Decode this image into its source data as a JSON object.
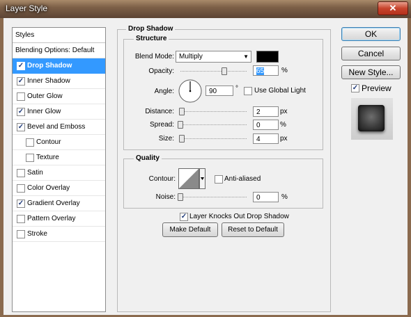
{
  "window": {
    "title": "Layer Style",
    "close_glyph": "✕"
  },
  "styles_panel": {
    "header": "Styles",
    "items": [
      {
        "label": "Blending Options: Default",
        "checkbox": false,
        "checked": false,
        "indent": 0,
        "selected": false
      },
      {
        "label": "Drop Shadow",
        "checkbox": true,
        "checked": true,
        "indent": 0,
        "selected": true
      },
      {
        "label": "Inner Shadow",
        "checkbox": true,
        "checked": true,
        "indent": 0,
        "selected": false
      },
      {
        "label": "Outer Glow",
        "checkbox": true,
        "checked": false,
        "indent": 0,
        "selected": false
      },
      {
        "label": "Inner Glow",
        "checkbox": true,
        "checked": true,
        "indent": 0,
        "selected": false
      },
      {
        "label": "Bevel and Emboss",
        "checkbox": true,
        "checked": true,
        "indent": 0,
        "selected": false
      },
      {
        "label": "Contour",
        "checkbox": true,
        "checked": false,
        "indent": 1,
        "selected": false
      },
      {
        "label": "Texture",
        "checkbox": true,
        "checked": false,
        "indent": 1,
        "selected": false
      },
      {
        "label": "Satin",
        "checkbox": true,
        "checked": false,
        "indent": 0,
        "selected": false
      },
      {
        "label": "Color Overlay",
        "checkbox": true,
        "checked": false,
        "indent": 0,
        "selected": false
      },
      {
        "label": "Gradient Overlay",
        "checkbox": true,
        "checked": true,
        "indent": 0,
        "selected": false
      },
      {
        "label": "Pattern Overlay",
        "checkbox": true,
        "checked": false,
        "indent": 0,
        "selected": false
      },
      {
        "label": "Stroke",
        "checkbox": true,
        "checked": false,
        "indent": 0,
        "selected": false
      }
    ]
  },
  "drop_shadow": {
    "title": "Drop Shadow",
    "structure": {
      "title": "Structure",
      "blend_mode_label": "Blend Mode:",
      "blend_mode_value": "Multiply",
      "shadow_color": "#000000",
      "opacity_label": "Opacity:",
      "opacity_value": "65",
      "opacity_unit": "%",
      "opacity_fraction": 0.65,
      "angle_label": "Angle:",
      "angle_value": "90",
      "angle_unit": "°",
      "use_global_light_label": "Use Global Light",
      "use_global_light_checked": false,
      "distance_label": "Distance:",
      "distance_value": "2",
      "distance_unit": "px",
      "spread_label": "Spread:",
      "spread_value": "0",
      "spread_unit": "%",
      "size_label": "Size:",
      "size_value": "4",
      "size_unit": "px"
    },
    "quality": {
      "title": "Quality",
      "contour_label": "Contour:",
      "anti_aliased_label": "Anti-aliased",
      "anti_aliased_checked": false,
      "noise_label": "Noise:",
      "noise_value": "0",
      "noise_unit": "%"
    },
    "knockout_label": "Layer Knocks Out Drop Shadow",
    "knockout_checked": true,
    "make_default_label": "Make Default",
    "reset_default_label": "Reset to Default"
  },
  "actions": {
    "ok": "OK",
    "cancel": "Cancel",
    "new_style": "New Style...",
    "preview_label": "Preview",
    "preview_checked": true
  },
  "check_glyph": "✓",
  "dropdown_glyph": "▼"
}
